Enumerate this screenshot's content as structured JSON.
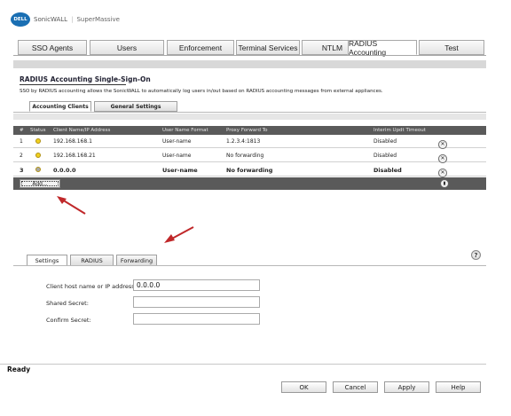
{
  "header": {
    "logo_text": "DELL",
    "brand": "SonicWALL",
    "model": "SuperMassive"
  },
  "top_tabs": [
    {
      "label": "SSO Agents"
    },
    {
      "label": "Users"
    },
    {
      "label": "Enforcement"
    },
    {
      "label": "Terminal Services"
    },
    {
      "label": "NTLM"
    },
    {
      "label": "RADIUS Accounting"
    },
    {
      "label": "Test"
    }
  ],
  "section": {
    "title": "RADIUS Accounting Single-Sign-On",
    "description": "SSO by RADIUS accounting allows the SonicWALL to automatically log users in/out based on RADIUS accounting messages from external appliances."
  },
  "sub_tabs": [
    {
      "label": "Accounting Clients"
    },
    {
      "label": "General Settings"
    }
  ],
  "table": {
    "headers": [
      "#",
      "Status",
      "Client Name/IP Address",
      "User Name Format",
      "Proxy Forward To",
      "Interim Updt Timeout"
    ],
    "rows": [
      {
        "num": "1",
        "status_color": "#f0d020",
        "client": "192.168.168.1",
        "format": "User-name",
        "proxy": "1.2.3.4:1813",
        "timeout": "Disabled"
      },
      {
        "num": "2",
        "status_color": "#f0d020",
        "client": "192.168.168.21",
        "format": "User-name",
        "proxy": "No forwarding",
        "timeout": "Disabled"
      },
      {
        "num": "3",
        "status_color": "#a8a8a8",
        "client": "0.0.0.0",
        "format": "User-name",
        "proxy": "No forwarding",
        "timeout": "Disabled"
      }
    ],
    "add_label": "Add..."
  },
  "lower_tabs": [
    {
      "label": "Settings"
    },
    {
      "label": "RADIUS"
    },
    {
      "label": "Forwarding"
    }
  ],
  "form": {
    "host_label": "Client host name or IP address:",
    "host_value": "0.0.0.0",
    "secret_label": "Shared Secret:",
    "secret_value": "",
    "confirm_label": "Confirm Secret:",
    "confirm_value": ""
  },
  "help_glyph": "?",
  "status": {
    "text": "Ready"
  },
  "buttons": {
    "ok": "OK",
    "cancel": "Cancel",
    "apply": "Apply",
    "help": "Help"
  },
  "colors": {
    "arrow": "#c0282a",
    "table_header": "#5a5a5a",
    "logo": "#1a6fb3"
  }
}
